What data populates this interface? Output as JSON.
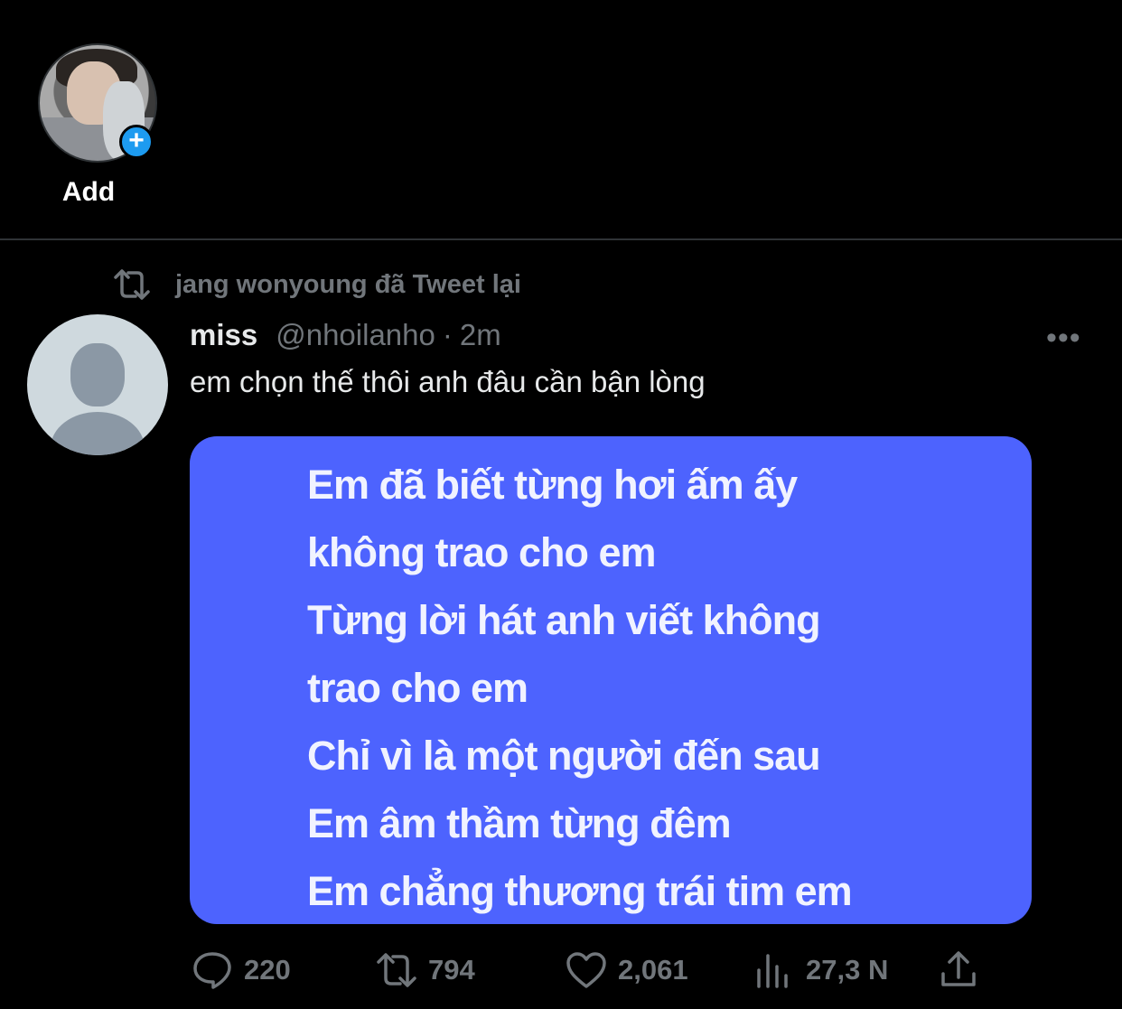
{
  "fleets": {
    "items": [
      {
        "label": "Add"
      }
    ]
  },
  "tweet": {
    "retweet_context": "jang wonyoung đã Tweet lại",
    "author_name": "miss",
    "author_handle": "@nhoilanho",
    "separator": "·",
    "time": "2m",
    "text": "em chọn thế thôi anh đâu cần bận lòng",
    "media_lines": [
      "Em đã biết từng hơi ấm ấy",
      "không trao cho em",
      "Từng lời hát anh viết không",
      "trao cho em",
      "Chỉ vì là một người đến sau",
      "Em âm thầm từng đêm",
      "Em chẳng thương trái tim em"
    ],
    "media_bg_color": "#4d63fe",
    "actions": {
      "replies": "220",
      "retweets": "794",
      "likes": "2,061",
      "views": "27,3 N"
    }
  },
  "colors": {
    "background": "#000000",
    "muted": "#71767b",
    "accent": "#1d9bf0"
  }
}
